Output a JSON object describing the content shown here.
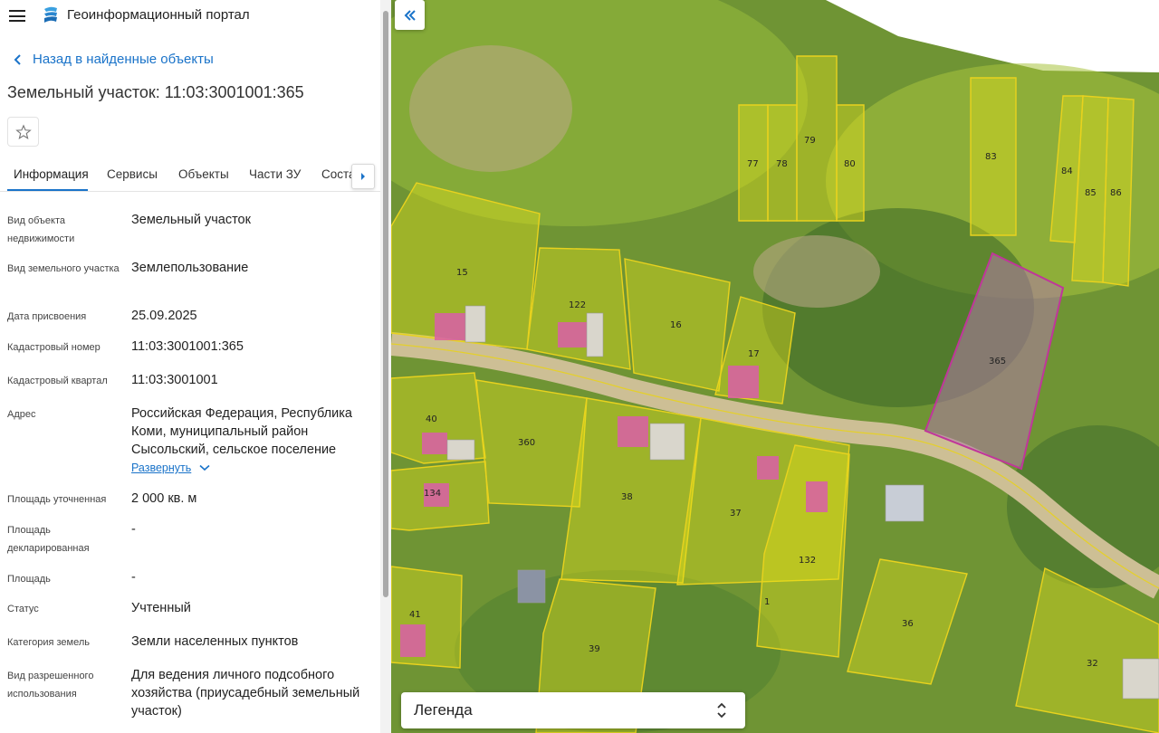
{
  "header": {
    "menu_icon": "hamburger-icon",
    "logo_icon": "portal-logo-icon",
    "app_title": "Геоинформационный портал"
  },
  "back_link": {
    "label": "Назад в найденные объекты",
    "icon": "chevron-left-icon"
  },
  "object_title": "Земельный участок: 11:03:3001001:365",
  "favorite_icon": "star-icon",
  "tabs": [
    {
      "label": "Информация",
      "active": true
    },
    {
      "label": "Сервисы",
      "active": false
    },
    {
      "label": "Объекты",
      "active": false
    },
    {
      "label": "Части ЗУ",
      "active": false
    },
    {
      "label": "Соста",
      "active": false
    }
  ],
  "tabs_scroll_icon": "chevron-right-icon",
  "properties": {
    "kind_label": "Вид объекта недвижимости",
    "kind_value": "Земельный участок",
    "parcel_kind_label": "Вид земельного участка",
    "parcel_kind_value": "Землепользование",
    "date_label": "Дата присвоения",
    "date_value": "25.09.2025",
    "cad_number_label": "Кадастровый номер",
    "cad_number_value": "11:03:3001001:365",
    "cad_block_label": "Кадастровый квартал",
    "cad_block_value": "11:03:3001001",
    "address_label": "Адрес",
    "address_value": "Российская Федерация, Республика Коми, муниципальный район Сысольский, сельское поселение",
    "expand_label": "Развернуть",
    "area_spec_label": "Площадь уточненная",
    "area_spec_value": "2 000 кв. м",
    "area_decl_label": "Площадь декларированная",
    "area_decl_value": "-",
    "area_label": "Площадь",
    "area_value": "-",
    "status_label": "Статус",
    "status_value": "Учтенный",
    "category_label": "Категория земель",
    "category_value": "Земли населенных пунктов",
    "usage_label": "Вид разрешенного использования",
    "usage_value": "Для ведения личного подсобного хозяйства (приусадебный земельный участок)"
  },
  "map": {
    "collapse_icon": "double-chevron-left-icon",
    "legend_label": "Легенда",
    "legend_toggle_icon": "up-down-chevron-icon",
    "parcel_numbers": [
      "79",
      "77",
      "78",
      "80",
      "83",
      "84",
      "85",
      "86",
      "15",
      "122",
      "16",
      "17",
      "365",
      "40",
      "360",
      "134",
      "38",
      "37",
      "132",
      "1",
      "41",
      "39",
      "36",
      "32"
    ],
    "selected_parcel": "365",
    "colors": {
      "parcel_fill": "#e6e21a",
      "parcel_border": "#e8d21e",
      "selected_border": "#c0369a",
      "road": "#c8b98f",
      "building_highlight": "#d95ea8"
    }
  }
}
